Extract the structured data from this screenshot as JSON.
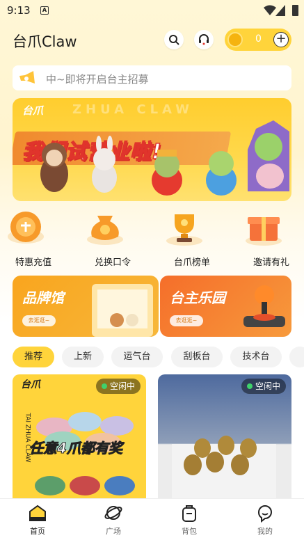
{
  "status_bar": {
    "time": "9:13",
    "notification_badge": "A"
  },
  "header": {
    "title": "台爪Claw",
    "coin_count": "0"
  },
  "notice": {
    "text": "中~即将开启台主招募"
  },
  "banner": {
    "logo": "台爪",
    "watermark": "ZHUA CLAW",
    "headline": "我们试营业啦!"
  },
  "quick_nav": [
    {
      "label": "特惠充值",
      "icon": "recharge-coin-icon"
    },
    {
      "label": "兑换口令",
      "icon": "redeem-bag-icon"
    },
    {
      "label": "台爪榜单",
      "icon": "trophy-icon"
    },
    {
      "label": "邀请有礼",
      "icon": "gift-box-icon"
    }
  ],
  "promos": [
    {
      "title": "品牌馆",
      "button": "去逛逛~"
    },
    {
      "title": "台主乐园",
      "button": "去逛逛~"
    }
  ],
  "tabs": [
    "推荐",
    "上新",
    "运气台",
    "刮板台",
    "技术台"
  ],
  "active_tab": "推荐",
  "cards": [
    {
      "status": "空闲中",
      "brand": "台爪",
      "side_text": "TAI ZHUA CLAW",
      "slogan": "任意4爪都有奖"
    },
    {
      "status": "空闲中"
    }
  ],
  "bottom_nav": [
    {
      "label": "首页",
      "icon": "home-icon"
    },
    {
      "label": "广场",
      "icon": "planet-icon"
    },
    {
      "label": "背包",
      "icon": "backpack-icon"
    },
    {
      "label": "我的",
      "icon": "profile-icon"
    }
  ],
  "colors": {
    "accent": "#FFD43B",
    "banner_red": "#E0342C",
    "promo_orange": "#F7A21B",
    "status_green": "#3FD16B"
  }
}
